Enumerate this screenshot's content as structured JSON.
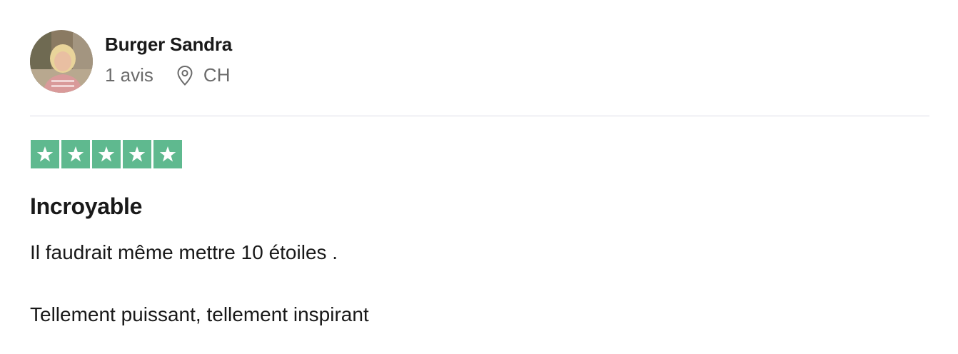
{
  "reviewer": {
    "name": "Burger Sandra",
    "review_count": "1 avis",
    "country": "CH",
    "avatar_icon": "user-photo",
    "location_icon": "location-pin-icon"
  },
  "rating": {
    "stars": 5,
    "max": 5,
    "star_color": "#5fb98f",
    "icon": "star-icon"
  },
  "review": {
    "title": "Incroyable",
    "paragraphs": [
      "Il faudrait même mettre 10 étoiles .",
      "Tellement puissant, tellement inspirant"
    ]
  },
  "colors": {
    "text_primary": "#191919",
    "text_secondary": "#6b6b6b",
    "divider": "#dcdce6",
    "star_green": "#5fb98f"
  }
}
